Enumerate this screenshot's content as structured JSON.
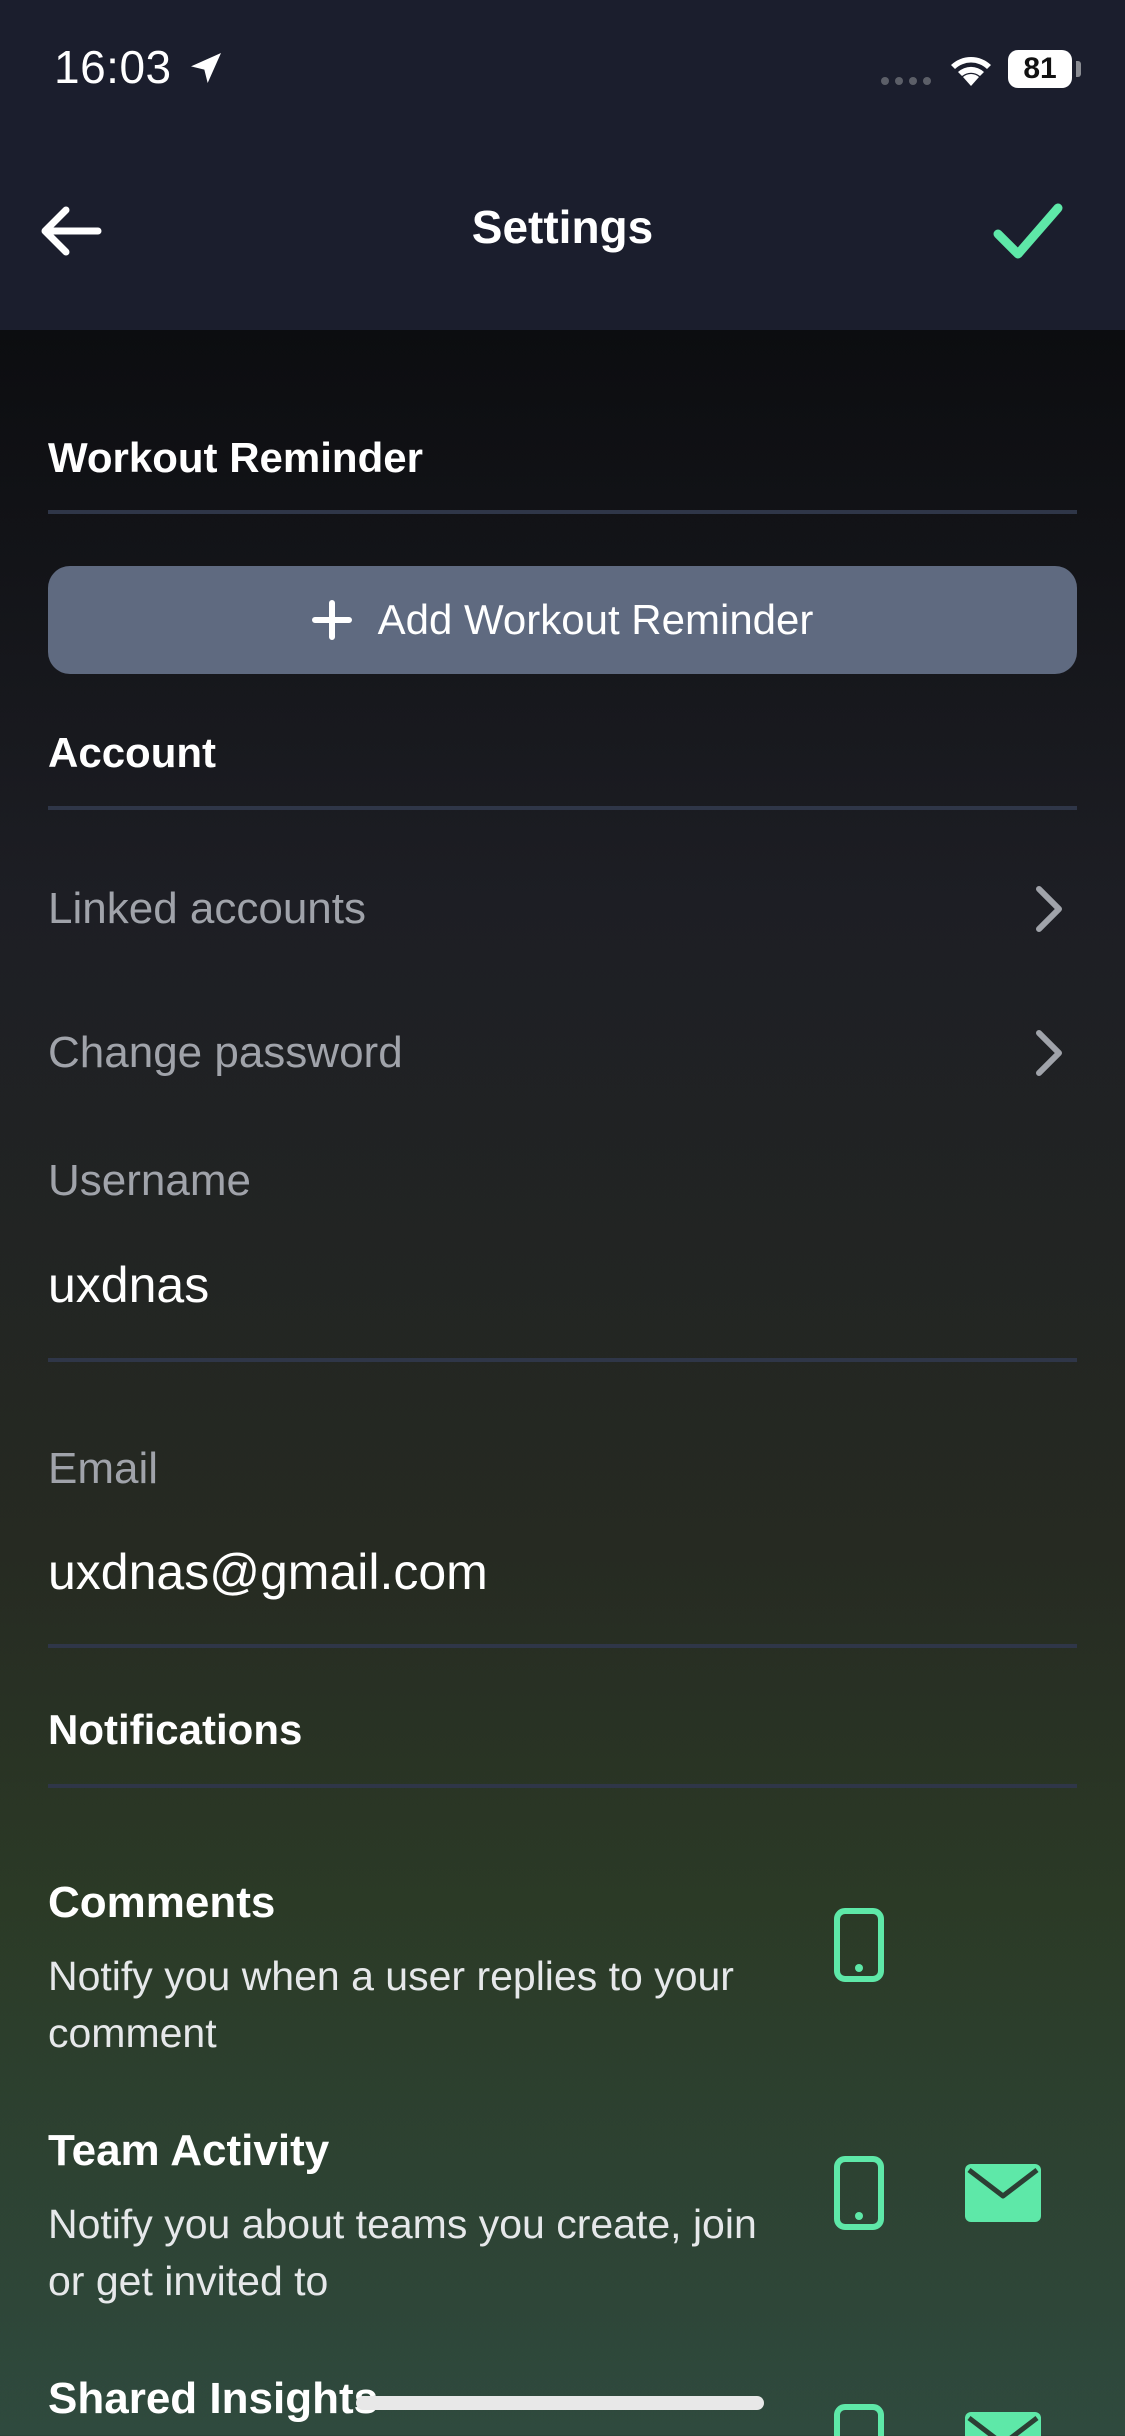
{
  "status_bar": {
    "time": "16:03",
    "battery": "81"
  },
  "header": {
    "title": "Settings",
    "back_icon": "arrow-left-icon",
    "confirm_icon": "checkmark-icon",
    "accent_color": "#5ee8a8"
  },
  "workout_reminder": {
    "section_title": "Workout Reminder",
    "add_button_label": "Add Workout Reminder"
  },
  "account": {
    "section_title": "Account",
    "linked_accounts_label": "Linked accounts",
    "change_password_label": "Change password",
    "username_label": "Username",
    "username_value": "uxdnas",
    "email_label": "Email",
    "email_value": "uxdnas@gmail.com"
  },
  "notifications": {
    "section_title": "Notifications",
    "items": [
      {
        "title": "Comments",
        "description": "Notify you when a user replies to your comment",
        "channels": [
          "phone"
        ]
      },
      {
        "title": "Team Activity",
        "description": "Notify you about teams you create, join or get invited to",
        "channels": [
          "phone",
          "mail"
        ]
      },
      {
        "title": "Shared Insights",
        "channels": [
          "phone",
          "mail"
        ]
      }
    ]
  }
}
